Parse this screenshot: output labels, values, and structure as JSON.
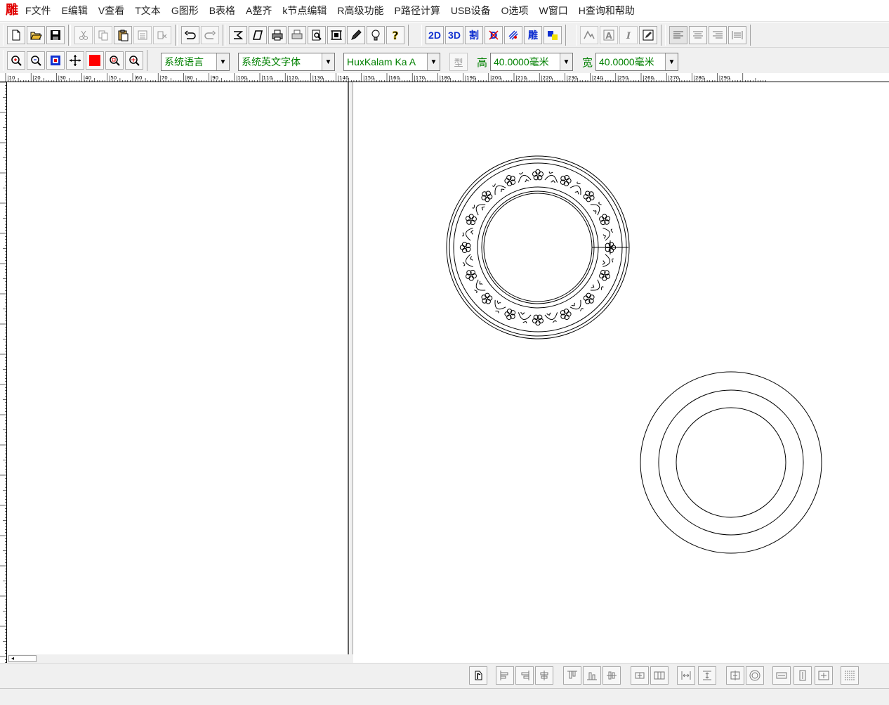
{
  "app": {
    "logo_glyph": "雕",
    "accent": "#e00000"
  },
  "menu": [
    "F文件",
    "E编辑",
    "V查看",
    "T文本",
    "G图形",
    "B表格",
    "A整齐",
    "k节点编辑",
    "R高级功能",
    "P路径计算",
    "USB设备",
    "O选项",
    "W窗口",
    "H查询和帮助"
  ],
  "toolbar1": {
    "file_icons": [
      "new-file-icon",
      "open-folder-icon",
      "save-icon"
    ],
    "edit_icons": [
      "cut-icon",
      "copy-icon",
      "paste-icon",
      "paste-special-icon",
      "clear-icon"
    ],
    "history_icons": [
      "undo-icon",
      "redo-icon"
    ],
    "misc_icons": [
      "send-icon",
      "italic-frame-icon",
      "print-icon",
      "print-setup-icon",
      "preview-icon",
      "frame-icon",
      "pen-icon",
      "bulb-icon",
      "help-icon"
    ],
    "buttons_2d": "2D",
    "buttons_3d": "3D",
    "cut_label": "割",
    "carve_label": "雕",
    "right_icons": [
      "text-outline-icon",
      "text-box-icon",
      "italic-icon",
      "edit-text-icon"
    ],
    "align_icons": [
      "align-left-icon",
      "align-center-icon",
      "align-right-icon",
      "justify-icon"
    ]
  },
  "toolbar2": {
    "zoom_icons": [
      "zoom-in-icon",
      "zoom-out-icon",
      "zoom-fit-icon",
      "pan-icon",
      "color-icon",
      "zoom-window-icon",
      "zoom-all-icon"
    ],
    "language_select": "系统语言",
    "font_en_select": "系统英文字体",
    "font_select": "HuxKalam Ka A",
    "style_label": "型",
    "height_label": "高",
    "height_value": "40.0000毫米",
    "width_label": "宽",
    "width_value": "40.0000毫米"
  },
  "ruler": {
    "h_labels": [
      "|10",
      "|20",
      "|30",
      "|40",
      "|50",
      "|60",
      "|70",
      "|80",
      "|90",
      "|100",
      "|110",
      "|120",
      "|130",
      "|140",
      "|150",
      "|160",
      "|170",
      "|180",
      "|190",
      "|200",
      "|210",
      "|220",
      "|230",
      "|240",
      "|250",
      "|260",
      "|270",
      "|280",
      "|290"
    ]
  },
  "bottom_toolbar": {
    "icons": [
      "node-icon",
      "align-left-edge-icon",
      "align-right-edge-icon",
      "align-hcenter-icon",
      "align-top-icon",
      "align-bottom-icon",
      "align-vcenter-icon",
      "distribute-h-icon",
      "distribute-v-icon",
      "space-h-icon",
      "space-v-icon",
      "center-icon",
      "concentric-icon",
      "same-width-icon",
      "same-height-icon",
      "same-size-icon",
      "grid-icon"
    ]
  },
  "canvas": {
    "shapes": [
      "ornamental-ring",
      "plain-rings"
    ]
  }
}
